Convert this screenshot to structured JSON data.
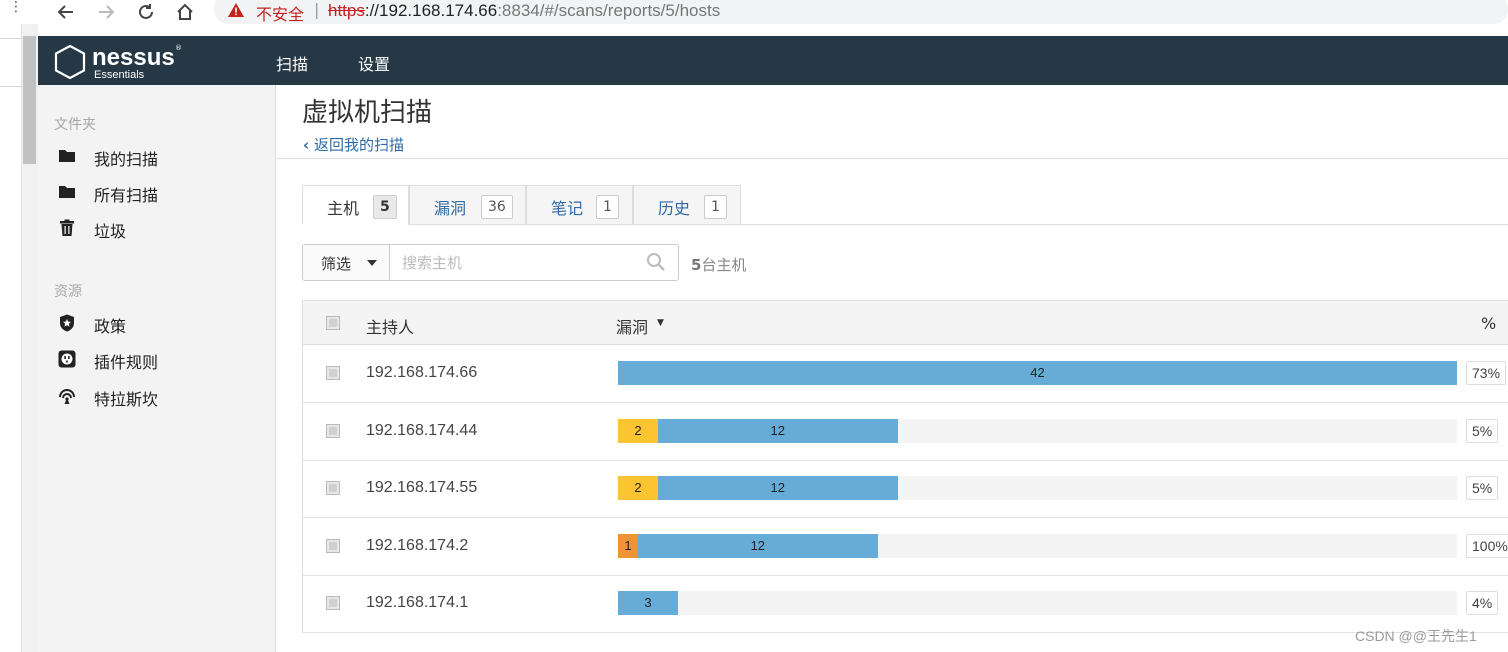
{
  "browser": {
    "insecure_label": "不安全",
    "url_scheme": "https",
    "url_host": "://192.168.174.66",
    "url_rest": ":8834/#/scans/reports/5/hosts"
  },
  "header": {
    "logo_name": "nessus",
    "logo_sub": "Essentials",
    "nav": [
      "扫描",
      "设置"
    ]
  },
  "sidebar": {
    "folders_title": "文件夹",
    "folders": [
      {
        "label": "我的扫描",
        "icon": "folder-icon"
      },
      {
        "label": "所有扫描",
        "icon": "folder-icon"
      },
      {
        "label": "垃圾",
        "icon": "trash-icon"
      }
    ],
    "resources_title": "资源",
    "resources": [
      {
        "label": "政策",
        "icon": "shield-icon"
      },
      {
        "label": "插件规则",
        "icon": "plug-icon"
      },
      {
        "label": "特拉斯坎",
        "icon": "signal-icon"
      }
    ]
  },
  "page": {
    "title": "虚拟机扫描",
    "back_link": "返回我的扫描"
  },
  "tabs": [
    {
      "label": "主机",
      "count": "5",
      "active": true
    },
    {
      "label": "漏洞",
      "count": "36",
      "active": false
    },
    {
      "label": "笔记",
      "count": "1",
      "active": false
    },
    {
      "label": "历史",
      "count": "1",
      "active": false
    }
  ],
  "filter": {
    "label": "筛选",
    "search_placeholder": "搜索主机",
    "host_count_num": "5",
    "host_count_text": "台主机"
  },
  "table": {
    "headers": {
      "host": "主持人",
      "vulns": "漏洞",
      "sort": "▼",
      "percent": "%"
    },
    "max_total": 42,
    "colors": {
      "critical": "#e8433e",
      "high": "#ee9336",
      "medium": "#fdc431",
      "low": "#67acd6",
      "info": "#67acd6"
    },
    "rows": [
      {
        "host": "192.168.174.66",
        "segments": [
          {
            "severity": "info",
            "value": 42
          }
        ],
        "percent": "73%"
      },
      {
        "host": "192.168.174.44",
        "segments": [
          {
            "severity": "medium",
            "value": 2
          },
          {
            "severity": "info",
            "value": 12
          }
        ],
        "percent": "5%"
      },
      {
        "host": "192.168.174.55",
        "segments": [
          {
            "severity": "medium",
            "value": 2
          },
          {
            "severity": "info",
            "value": 12
          }
        ],
        "percent": "5%"
      },
      {
        "host": "192.168.174.2",
        "segments": [
          {
            "severity": "high",
            "value": 1
          },
          {
            "severity": "info",
            "value": 12
          }
        ],
        "percent": "100%"
      },
      {
        "host": "192.168.174.1",
        "segments": [
          {
            "severity": "info",
            "value": 3
          }
        ],
        "percent": "4%"
      }
    ]
  },
  "watermark": "CSDN @@王先生1"
}
